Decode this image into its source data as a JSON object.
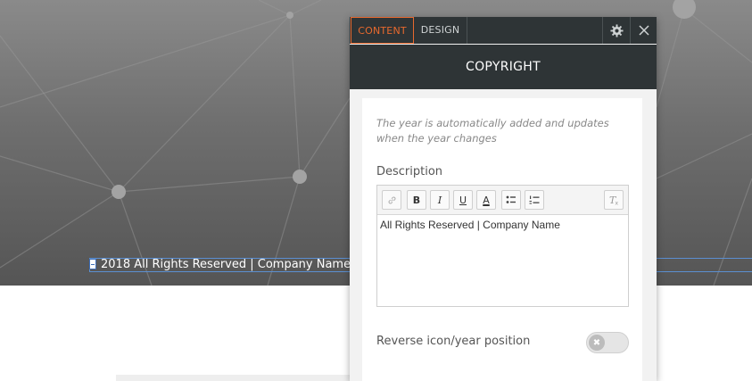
{
  "background": {
    "footer_text": "2018  All Rights Reserved | Company Name"
  },
  "panel": {
    "tabs": [
      {
        "label": "CONTENT",
        "active": true
      },
      {
        "label": "DESIGN",
        "active": false
      }
    ],
    "title": "COPYRIGHT",
    "hint": "The year is automatically added and updates when the year changes",
    "description_label": "Description",
    "editor_text": "All Rights Reserved | Company Name",
    "toolbar": {
      "link": "link-icon",
      "bold": "B",
      "italic": "I",
      "underline": "U",
      "color": "A",
      "bullets": "bullet-list-icon",
      "numbered": "numbered-list-icon",
      "clear": "clear-format-icon"
    },
    "toggle_label": "Reverse icon/year position",
    "toggle_on": false
  },
  "colors": {
    "accent": "#e8692e",
    "header_bg": "#2e3436",
    "selection": "#5b8fd1"
  }
}
